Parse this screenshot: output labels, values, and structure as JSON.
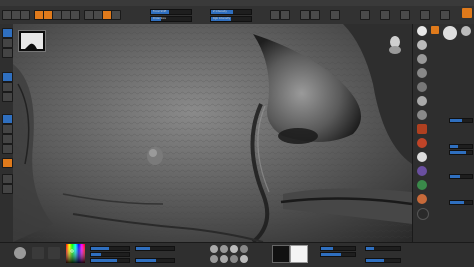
{
  "app": {
    "name": "ZBrush"
  },
  "colors": {
    "accent": "#e07a1b",
    "highlight": "#2f6fbf",
    "ui_bg": "#2b2b2b",
    "viewport_bg": "#3b3b3b"
  },
  "topbar": {
    "sliders": [
      {
        "label": "Focal Shift",
        "value": 0.45
      },
      {
        "label": "Draw Size",
        "value": 0.25
      },
      {
        "label": "Z Intensity",
        "value": 0.55
      },
      {
        "label": "Rgb Intensity",
        "value": 0.5
      }
    ]
  },
  "icons": [
    "draw-icon",
    "move-icon",
    "scale-icon",
    "rotate-icon",
    "edit-icon",
    "brush-icon",
    "stroke-icon",
    "alpha-icon",
    "texture-icon",
    "material-icon",
    "gizmo-head-icon",
    "color-picker-icon"
  ]
}
